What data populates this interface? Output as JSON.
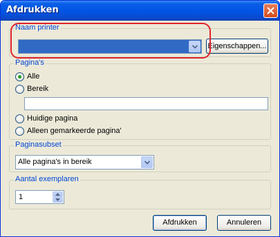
{
  "window": {
    "title": "Afdrukken"
  },
  "printer": {
    "group_label": "Naam printer",
    "selected": "",
    "properties_button": "Eigenschappen..."
  },
  "pages": {
    "group_label": "Pagina's",
    "options": [
      {
        "label": "Alle",
        "checked": true
      },
      {
        "label": "Bereik",
        "checked": false
      },
      {
        "label": "Huidige pagina",
        "checked": false
      },
      {
        "label": "Alleen gemarkeerde pagina'",
        "checked": false
      }
    ],
    "range_value": ""
  },
  "subset": {
    "group_label": "Paginasubset",
    "selected": "Alle pagina's in bereik"
  },
  "copies": {
    "group_label": "Aantal exemplaren",
    "value": "1"
  },
  "buttons": {
    "print": "Afdrukken",
    "cancel": "Annuleren"
  },
  "colors": {
    "titlebar": "#0054e3",
    "group_label": "#0046d5",
    "highlight": "#e0242b",
    "selection": "#316ac5"
  }
}
